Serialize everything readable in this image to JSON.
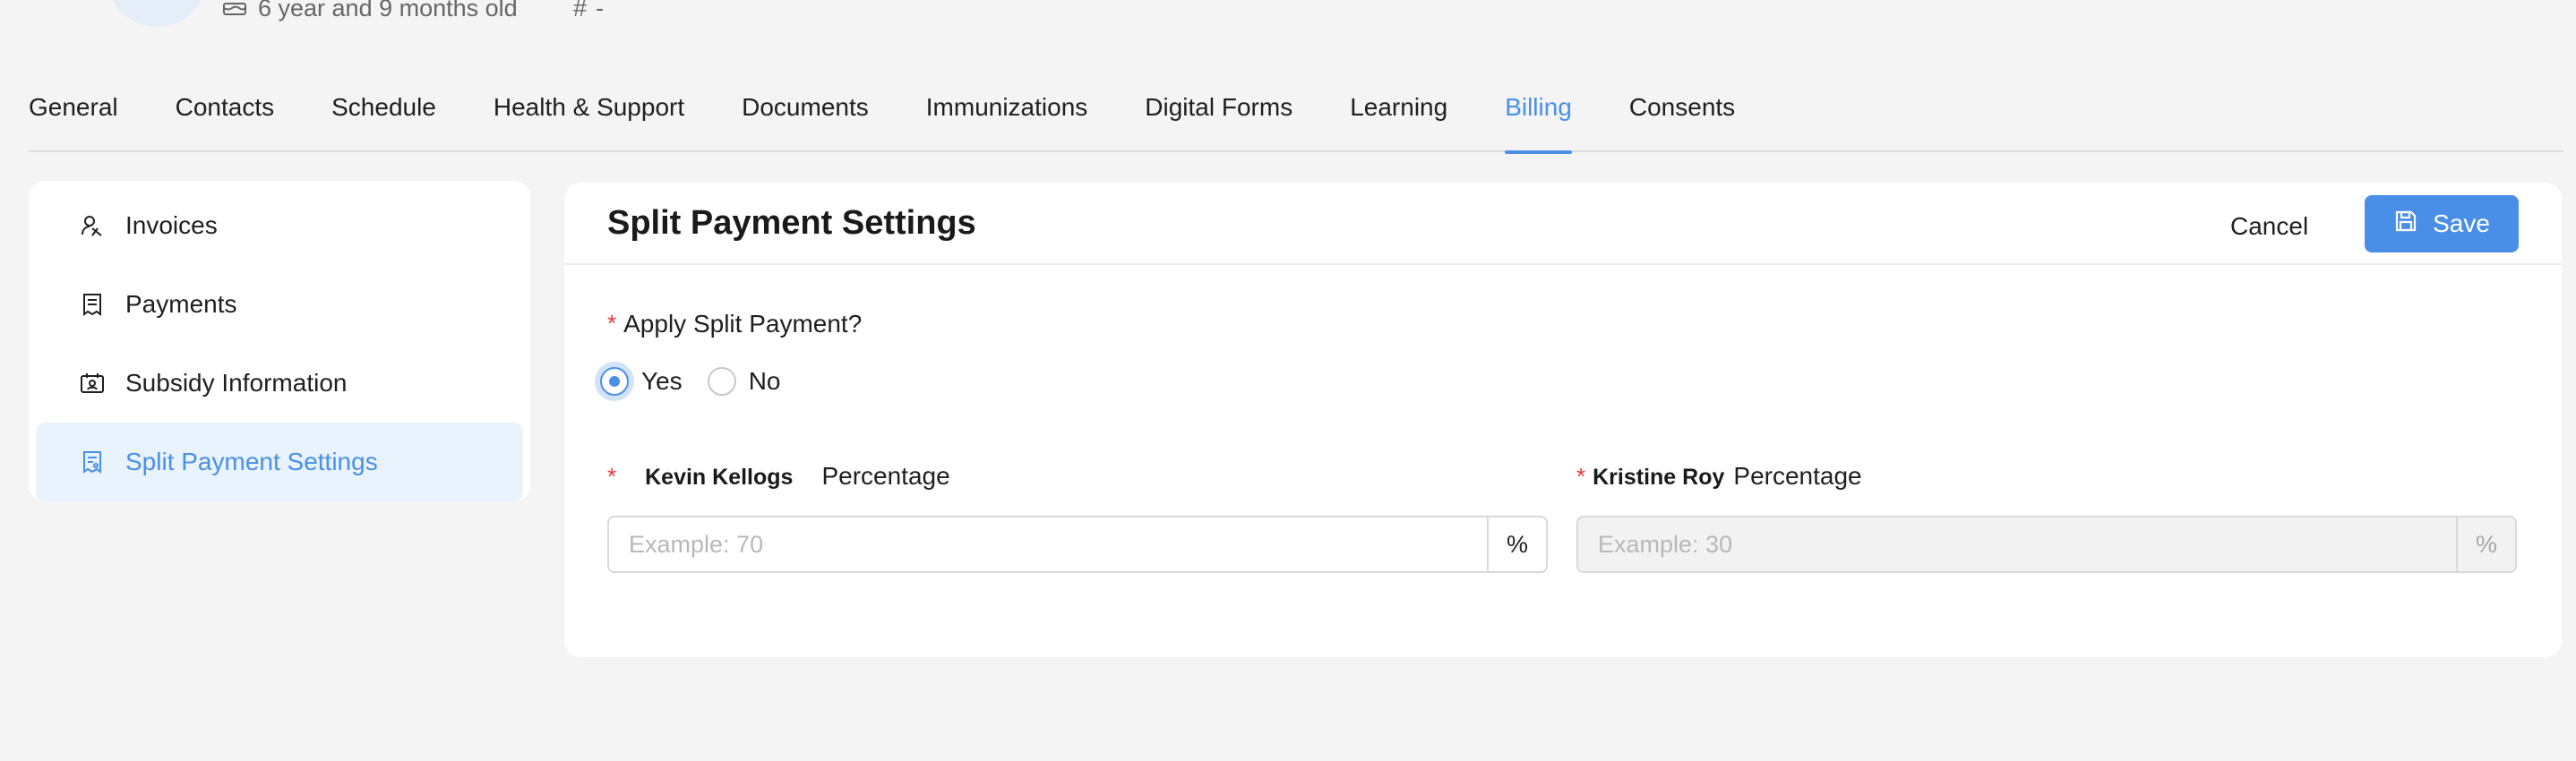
{
  "profile": {
    "age_text": "6 year and 9 months old",
    "hash_symbol": "#",
    "hash_value": "-"
  },
  "tabs": [
    {
      "label": "General"
    },
    {
      "label": "Contacts"
    },
    {
      "label": "Schedule"
    },
    {
      "label": "Health & Support"
    },
    {
      "label": "Documents"
    },
    {
      "label": "Immunizations"
    },
    {
      "label": "Digital Forms"
    },
    {
      "label": "Learning"
    },
    {
      "label": "Billing",
      "active": true
    },
    {
      "label": "Consents"
    }
  ],
  "sidebar": {
    "items": [
      {
        "label": "Invoices",
        "icon": "invoices-icon"
      },
      {
        "label": "Payments",
        "icon": "payments-icon"
      },
      {
        "label": "Subsidy Information",
        "icon": "subsidy-icon"
      },
      {
        "label": "Split Payment Settings",
        "icon": "split-payment-icon",
        "active": true
      }
    ]
  },
  "card": {
    "title": "Split Payment Settings",
    "cancel_label": "Cancel",
    "save_label": "Save",
    "question": {
      "required_mark": "*",
      "label": "Apply Split Payment?",
      "options": [
        {
          "label": "Yes",
          "checked": true
        },
        {
          "label": "No",
          "checked": false
        }
      ]
    },
    "fields": [
      {
        "required_mark": "*",
        "person": "Kevin Kellogs",
        "suffix": "Percentage",
        "placeholder": "Example: 70",
        "value": "",
        "addon": "%",
        "disabled": false
      },
      {
        "required_mark": "*",
        "person": "Kristine Roy",
        "suffix": "Percentage",
        "placeholder": "Example: 30",
        "value": "",
        "addon": "%",
        "disabled": true
      }
    ]
  },
  "colors": {
    "accent": "#4a8fe7",
    "required": "#e53935",
    "active_bg": "#e8f3fd",
    "page_bg": "#f4f4f4"
  }
}
